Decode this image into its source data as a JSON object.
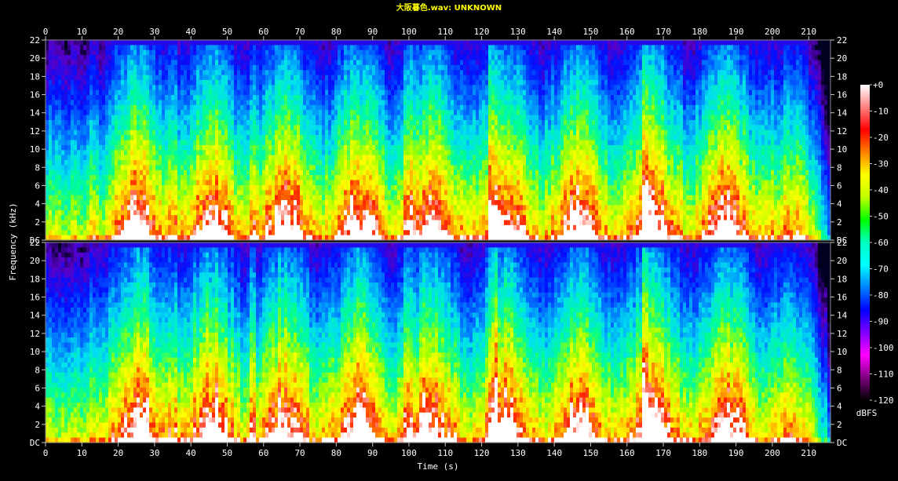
{
  "title": "大阪暮色.wav: UNKNOWN",
  "chart_data": {
    "type": "heatmap",
    "subtype": "spectrogram",
    "xlabel": "Time (s)",
    "ylabel": "Frequency (kHz)",
    "colorbar_label": "dBFS",
    "xlim": [
      0,
      216
    ],
    "ylim_khz": [
      0,
      22
    ],
    "x_ticks": [
      "0",
      "10",
      "20",
      "30",
      "40",
      "50",
      "60",
      "70",
      "80",
      "90",
      "100",
      "110",
      "120",
      "130",
      "140",
      "150",
      "160",
      "170",
      "180",
      "190",
      "200",
      "210"
    ],
    "y_ticks": [
      "DC",
      "2",
      "4",
      "6",
      "8",
      "10",
      "12",
      "14",
      "16",
      "18",
      "20",
      "22"
    ],
    "colorbar_ticks": [
      "+0",
      "-10",
      "-20",
      "-30",
      "-40",
      "-50",
      "-60",
      "-70",
      "-80",
      "-90",
      "-100",
      "-110",
      "-120"
    ],
    "colorbar_stops": [
      "#ffffff",
      "#ff8080",
      "#ff0000",
      "#ff8000",
      "#ffff00",
      "#c0ff00",
      "#00ff00",
      "#00ffc0",
      "#00ffff",
      "#0080ff",
      "#0000ff",
      "#8000ff",
      "#ff00ff",
      "#800080",
      "#000000"
    ],
    "channels": [
      {
        "name": "",
        "panel": "top"
      },
      {
        "name": "",
        "panel": "bottom"
      }
    ],
    "events": {
      "intro_end_s": 12,
      "dropout_s": [
        14,
        16
      ],
      "strong_onsets_s": [
        35,
        57,
        100,
        123,
        165
      ],
      "fade_out_start_s": 200,
      "end_s": 215
    }
  }
}
